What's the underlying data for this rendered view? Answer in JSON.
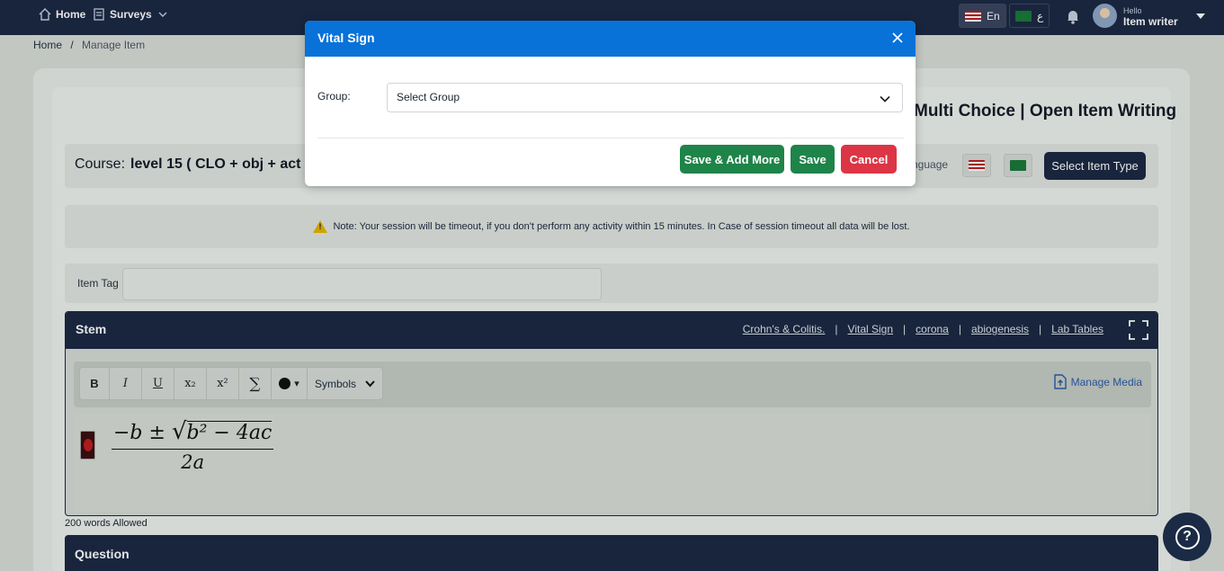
{
  "topbar": {
    "home": "Home",
    "surveys": "Surveys",
    "lang_en": "En",
    "lang_ar": "ع",
    "hello": "Hello",
    "user_name": "Item writer"
  },
  "breadcrumb": {
    "home": "Home",
    "separator": "/",
    "current": "Manage Item"
  },
  "page": {
    "title": "Multi Choice | Open Item Writing",
    "course_label": "Course:",
    "course_value": "level 15 ( CLO + obj + act + l",
    "language_label": "nguage",
    "select_item_type": "Select Item Type",
    "note": "Note: Your session will be timeout, if you don't perform any activity within 15 minutes. In Case of session timeout all data will be lost.",
    "item_tag_label": "Item Tag",
    "item_tag_value": ""
  },
  "stem": {
    "title": "Stem",
    "links": [
      "Crohn's & Colitis.",
      "Vital Sign",
      "corona",
      "abiogenesis",
      "Lab Tables"
    ],
    "link_separator": "|",
    "toolbar": {
      "bold": "B",
      "italic": "I",
      "underline": "U",
      "subscript": "x₂",
      "superscript": "x²",
      "sum": "∑",
      "color_arrow": "▾",
      "symbols": "Symbols"
    },
    "manage_media": "Manage Media",
    "formula_numerator_prefix": "−b ±",
    "formula_radicand": "b² − 4ac",
    "formula_denominator": "2a",
    "words_allowed": "200 words Allowed"
  },
  "question": {
    "title": "Question"
  },
  "modal": {
    "title": "Vital Sign",
    "group_label": "Group:",
    "group_select_value": "Select Group",
    "save_add_more": "Save & Add More",
    "save": "Save",
    "cancel": "Cancel"
  },
  "colors": {
    "navy": "#1b2a45",
    "modal_header": "#0872d9",
    "green": "#1e8449",
    "red": "#dc3545"
  },
  "icons": [
    "home-icon",
    "surveys-icon",
    "chevron-down-icon",
    "bell-icon",
    "flag-us-icon",
    "flag-sa-icon",
    "warning-icon",
    "expand-icon",
    "media-icon",
    "close-icon",
    "help-icon",
    "play-icon"
  ]
}
